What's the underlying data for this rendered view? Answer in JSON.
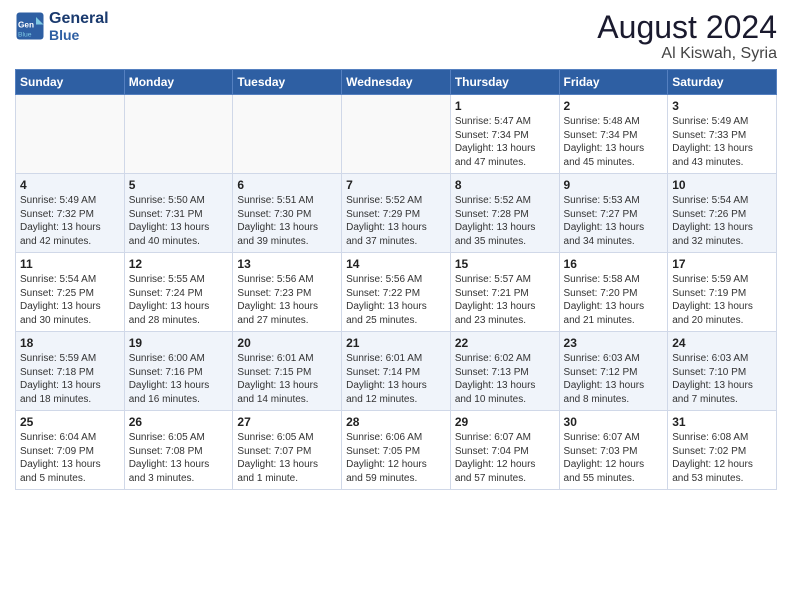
{
  "header": {
    "logo_line1": "General",
    "logo_line2": "Blue",
    "month": "August 2024",
    "location": "Al Kiswah, Syria"
  },
  "days_of_week": [
    "Sunday",
    "Monday",
    "Tuesday",
    "Wednesday",
    "Thursday",
    "Friday",
    "Saturday"
  ],
  "weeks": [
    [
      {
        "num": "",
        "info": ""
      },
      {
        "num": "",
        "info": ""
      },
      {
        "num": "",
        "info": ""
      },
      {
        "num": "",
        "info": ""
      },
      {
        "num": "1",
        "info": "Sunrise: 5:47 AM\nSunset: 7:34 PM\nDaylight: 13 hours\nand 47 minutes."
      },
      {
        "num": "2",
        "info": "Sunrise: 5:48 AM\nSunset: 7:34 PM\nDaylight: 13 hours\nand 45 minutes."
      },
      {
        "num": "3",
        "info": "Sunrise: 5:49 AM\nSunset: 7:33 PM\nDaylight: 13 hours\nand 43 minutes."
      }
    ],
    [
      {
        "num": "4",
        "info": "Sunrise: 5:49 AM\nSunset: 7:32 PM\nDaylight: 13 hours\nand 42 minutes."
      },
      {
        "num": "5",
        "info": "Sunrise: 5:50 AM\nSunset: 7:31 PM\nDaylight: 13 hours\nand 40 minutes."
      },
      {
        "num": "6",
        "info": "Sunrise: 5:51 AM\nSunset: 7:30 PM\nDaylight: 13 hours\nand 39 minutes."
      },
      {
        "num": "7",
        "info": "Sunrise: 5:52 AM\nSunset: 7:29 PM\nDaylight: 13 hours\nand 37 minutes."
      },
      {
        "num": "8",
        "info": "Sunrise: 5:52 AM\nSunset: 7:28 PM\nDaylight: 13 hours\nand 35 minutes."
      },
      {
        "num": "9",
        "info": "Sunrise: 5:53 AM\nSunset: 7:27 PM\nDaylight: 13 hours\nand 34 minutes."
      },
      {
        "num": "10",
        "info": "Sunrise: 5:54 AM\nSunset: 7:26 PM\nDaylight: 13 hours\nand 32 minutes."
      }
    ],
    [
      {
        "num": "11",
        "info": "Sunrise: 5:54 AM\nSunset: 7:25 PM\nDaylight: 13 hours\nand 30 minutes."
      },
      {
        "num": "12",
        "info": "Sunrise: 5:55 AM\nSunset: 7:24 PM\nDaylight: 13 hours\nand 28 minutes."
      },
      {
        "num": "13",
        "info": "Sunrise: 5:56 AM\nSunset: 7:23 PM\nDaylight: 13 hours\nand 27 minutes."
      },
      {
        "num": "14",
        "info": "Sunrise: 5:56 AM\nSunset: 7:22 PM\nDaylight: 13 hours\nand 25 minutes."
      },
      {
        "num": "15",
        "info": "Sunrise: 5:57 AM\nSunset: 7:21 PM\nDaylight: 13 hours\nand 23 minutes."
      },
      {
        "num": "16",
        "info": "Sunrise: 5:58 AM\nSunset: 7:20 PM\nDaylight: 13 hours\nand 21 minutes."
      },
      {
        "num": "17",
        "info": "Sunrise: 5:59 AM\nSunset: 7:19 PM\nDaylight: 13 hours\nand 20 minutes."
      }
    ],
    [
      {
        "num": "18",
        "info": "Sunrise: 5:59 AM\nSunset: 7:18 PM\nDaylight: 13 hours\nand 18 minutes."
      },
      {
        "num": "19",
        "info": "Sunrise: 6:00 AM\nSunset: 7:16 PM\nDaylight: 13 hours\nand 16 minutes."
      },
      {
        "num": "20",
        "info": "Sunrise: 6:01 AM\nSunset: 7:15 PM\nDaylight: 13 hours\nand 14 minutes."
      },
      {
        "num": "21",
        "info": "Sunrise: 6:01 AM\nSunset: 7:14 PM\nDaylight: 13 hours\nand 12 minutes."
      },
      {
        "num": "22",
        "info": "Sunrise: 6:02 AM\nSunset: 7:13 PM\nDaylight: 13 hours\nand 10 minutes."
      },
      {
        "num": "23",
        "info": "Sunrise: 6:03 AM\nSunset: 7:12 PM\nDaylight: 13 hours\nand 8 minutes."
      },
      {
        "num": "24",
        "info": "Sunrise: 6:03 AM\nSunset: 7:10 PM\nDaylight: 13 hours\nand 7 minutes."
      }
    ],
    [
      {
        "num": "25",
        "info": "Sunrise: 6:04 AM\nSunset: 7:09 PM\nDaylight: 13 hours\nand 5 minutes."
      },
      {
        "num": "26",
        "info": "Sunrise: 6:05 AM\nSunset: 7:08 PM\nDaylight: 13 hours\nand 3 minutes."
      },
      {
        "num": "27",
        "info": "Sunrise: 6:05 AM\nSunset: 7:07 PM\nDaylight: 13 hours\nand 1 minute."
      },
      {
        "num": "28",
        "info": "Sunrise: 6:06 AM\nSunset: 7:05 PM\nDaylight: 12 hours\nand 59 minutes."
      },
      {
        "num": "29",
        "info": "Sunrise: 6:07 AM\nSunset: 7:04 PM\nDaylight: 12 hours\nand 57 minutes."
      },
      {
        "num": "30",
        "info": "Sunrise: 6:07 AM\nSunset: 7:03 PM\nDaylight: 12 hours\nand 55 minutes."
      },
      {
        "num": "31",
        "info": "Sunrise: 6:08 AM\nSunset: 7:02 PM\nDaylight: 12 hours\nand 53 minutes."
      }
    ]
  ]
}
